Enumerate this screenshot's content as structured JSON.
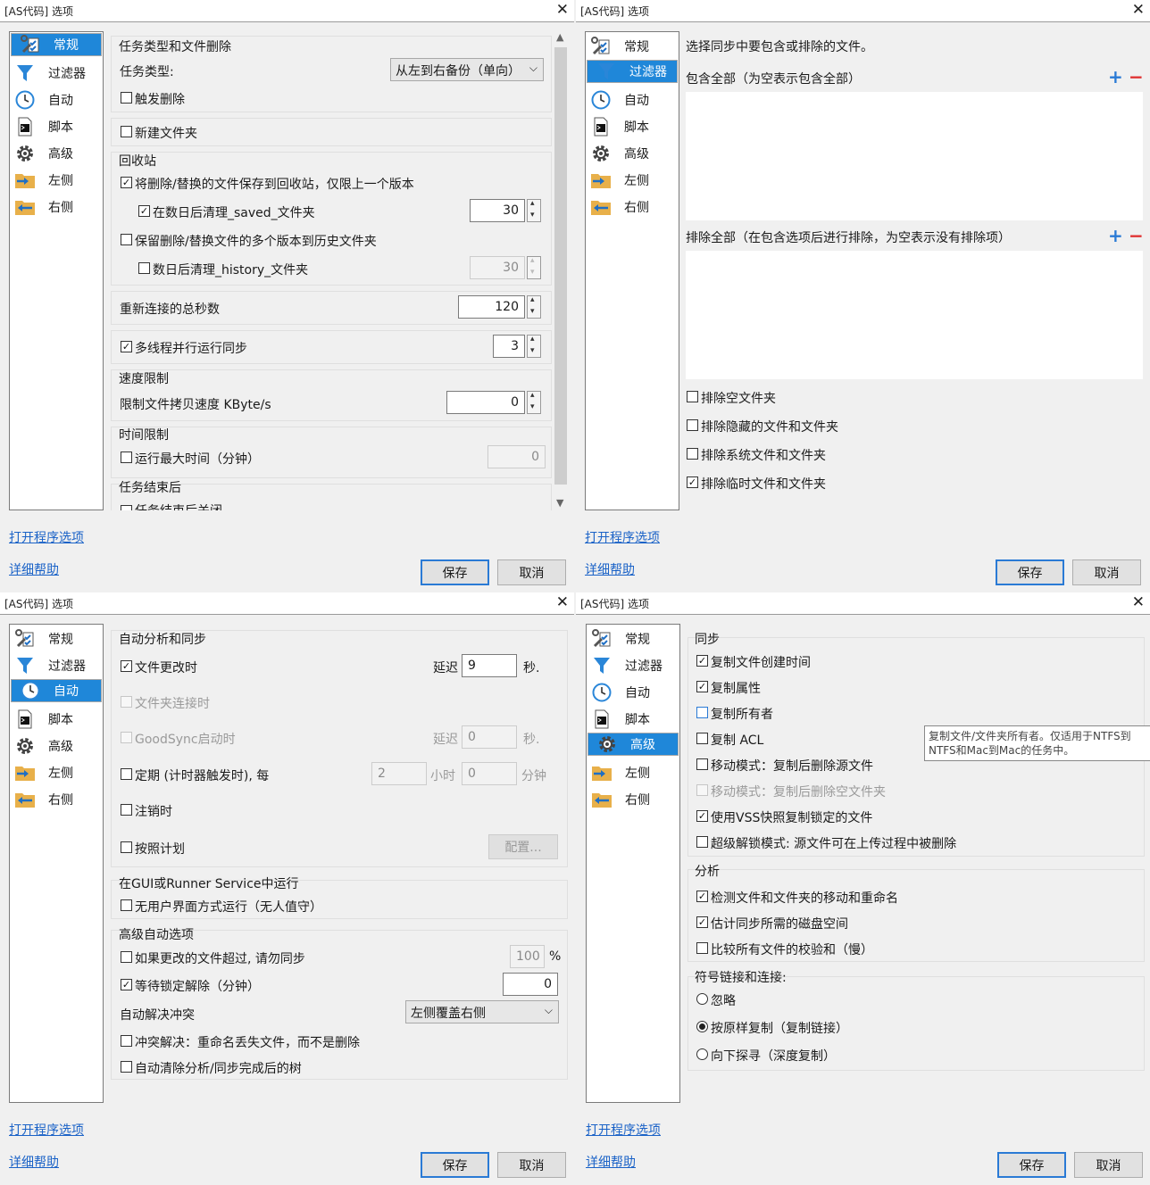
{
  "title": "[AS代码] 选项",
  "close_glyph": "✕",
  "sidebar": [
    {
      "label": "常规",
      "icon": "wrench-checklist-icon"
    },
    {
      "label": "过滤器",
      "icon": "funnel-icon"
    },
    {
      "label": "自动",
      "icon": "clock-icon"
    },
    {
      "label": "脚本",
      "icon": "terminal-icon"
    },
    {
      "label": "高级",
      "icon": "gear-icon"
    },
    {
      "label": "左侧",
      "icon": "folder-right-arrow-icon"
    },
    {
      "label": "右侧",
      "icon": "folder-left-arrow-icon"
    }
  ],
  "links": {
    "program_options": "打开程序选项",
    "help": "详细帮助"
  },
  "buttons": {
    "save": "保存",
    "cancel": "取消"
  },
  "general": {
    "job_group": "任务类型和文件删除",
    "job_type_label": "任务类型:",
    "job_type_value": "从左到右备份（单向）",
    "propagate_deletions": "触发删除",
    "create_folders": "新建文件夹",
    "recycle_title": "回收站",
    "save_to_saved": "将删除/替换的文件保存到回收站，仅限上一个版本",
    "clean_saved": "在数日后清理_saved_文件夹",
    "clean_saved_days": "30",
    "keep_history": "保留删除/替换文件的多个版本到历史文件夹",
    "clean_history": "数日后清理_history_文件夹",
    "clean_history_days": "30",
    "reconnect_label": "重新连接的总秒数",
    "reconnect_value": "120",
    "multithread_label": "多线程并行运行同步",
    "multithread_value": "3",
    "speed_title": "速度限制",
    "speed_label": "限制文件拷贝速度 KByte/s",
    "speed_value": "0",
    "time_title": "时间限制",
    "time_label": "运行最大时间（分钟）",
    "time_value": "0",
    "after_title": "任务结束后",
    "after_item": "任务结束后关闭"
  },
  "filters": {
    "intro": "选择同步中要包含或排除的文件。",
    "include_label": "包含全部（为空表示包含全部）",
    "exclude_label": "排除全部（在包含选项后进行排除，为空表示没有排除项）",
    "plus": "+",
    "minus": "−",
    "exclude_empty": "排除空文件夹",
    "exclude_hidden": "排除隐藏的文件和文件夹",
    "exclude_system": "排除系统文件和文件夹",
    "exclude_temp": "排除临时文件和文件夹"
  },
  "auto": {
    "group1": "自动分析和同步",
    "on_change": "文件更改时",
    "delay_label": "延迟",
    "delay_value": "9",
    "sec": "秒.",
    "on_folder_connect": "文件夹连接时",
    "on_goodsync_start": "GoodSync启动时",
    "delay2_value": "0",
    "periodic": "定期 (计时器触发时), 每",
    "hours_value": "2",
    "hours_label": "小时",
    "minutes_value": "0",
    "minutes_label": "分钟",
    "on_logoff": "注销时",
    "on_schedule": "按照计划",
    "config_button": "配置...",
    "group2": "在GUI或Runner Service中运行",
    "unattended": "无用户界面方式运行（无人值守）",
    "group3": "高级自动选项",
    "skip_if_changed": "如果更改的文件超过, 请勿同步",
    "skip_percent": "100",
    "percent_sign": "%",
    "wait_unlock": "等待锁定解除（分钟）",
    "wait_value": "0",
    "conflict_label": "自动解决冲突",
    "conflict_value": "左侧覆盖右侧",
    "rename_lost": "冲突解决：重命名丢失文件，而不是删除",
    "auto_clear": "自动清除分析/同步完成后的树"
  },
  "advanced": {
    "sync_title": "同步",
    "copy_create_time": "复制文件创建时间",
    "copy_attrs": "复制属性",
    "copy_owner": "复制所有者",
    "copy_acl": "复制 ACL",
    "move_mode": "移动模式：复制后删除源文件",
    "move_mode_folders": "移动模式：复制后删除空文件夹",
    "use_vss": "使用VSS快照复制锁定的文件",
    "super_unlock": "超级解锁模式: 源文件可在上传过程中被删除",
    "analysis_title": "分析",
    "detect_moves": "检测文件和文件夹的移动和重命名",
    "estimate_space": "估计同步所需的磁盘空间",
    "compare_checksums": "比较所有文件的校验和（慢）",
    "symlink_title": "符号链接和连接:",
    "ignore": "忽略",
    "copy_as_is": "按原样复制（复制链接）",
    "follow": "向下探寻（深度复制）",
    "tooltip": "复制文件/文件夹所有者。仅适用于NTFS到NTFS和Mac到Mac的任务中。"
  },
  "checks": {
    "on": "✓"
  }
}
